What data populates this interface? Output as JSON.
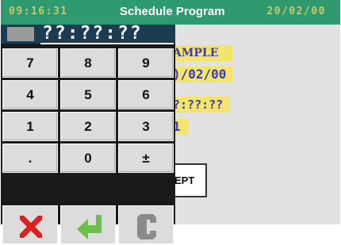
{
  "title_bar": {
    "time": "09:16:31",
    "title": "Schedule Program",
    "date": "20/02/00"
  },
  "form": {
    "name_value": "AMPLE",
    "date_value": ")/02/00",
    "time_value": "?:??:??",
    "repeat_value": "1",
    "accept_label": "EPT"
  },
  "keypad": {
    "display_value": "??:??:??",
    "keys": [
      "7",
      "8",
      "9",
      "4",
      "5",
      "6",
      "1",
      "2",
      "3",
      ".",
      "0",
      "±"
    ],
    "icons": [
      "cancel-x-icon",
      "enter-arrow-icon",
      "clear-c-icon"
    ]
  },
  "colors": {
    "title_bar_bg": "#2f9a70",
    "title_bar_clock": "#c8c96b",
    "field_bg": "#f2e56a",
    "field_text": "#3e3ab5",
    "display_bg": "#1d3c52",
    "cancel_red": "#e02020",
    "enter_green": "#6cc04a",
    "clear_gray": "#8a8a8a"
  }
}
